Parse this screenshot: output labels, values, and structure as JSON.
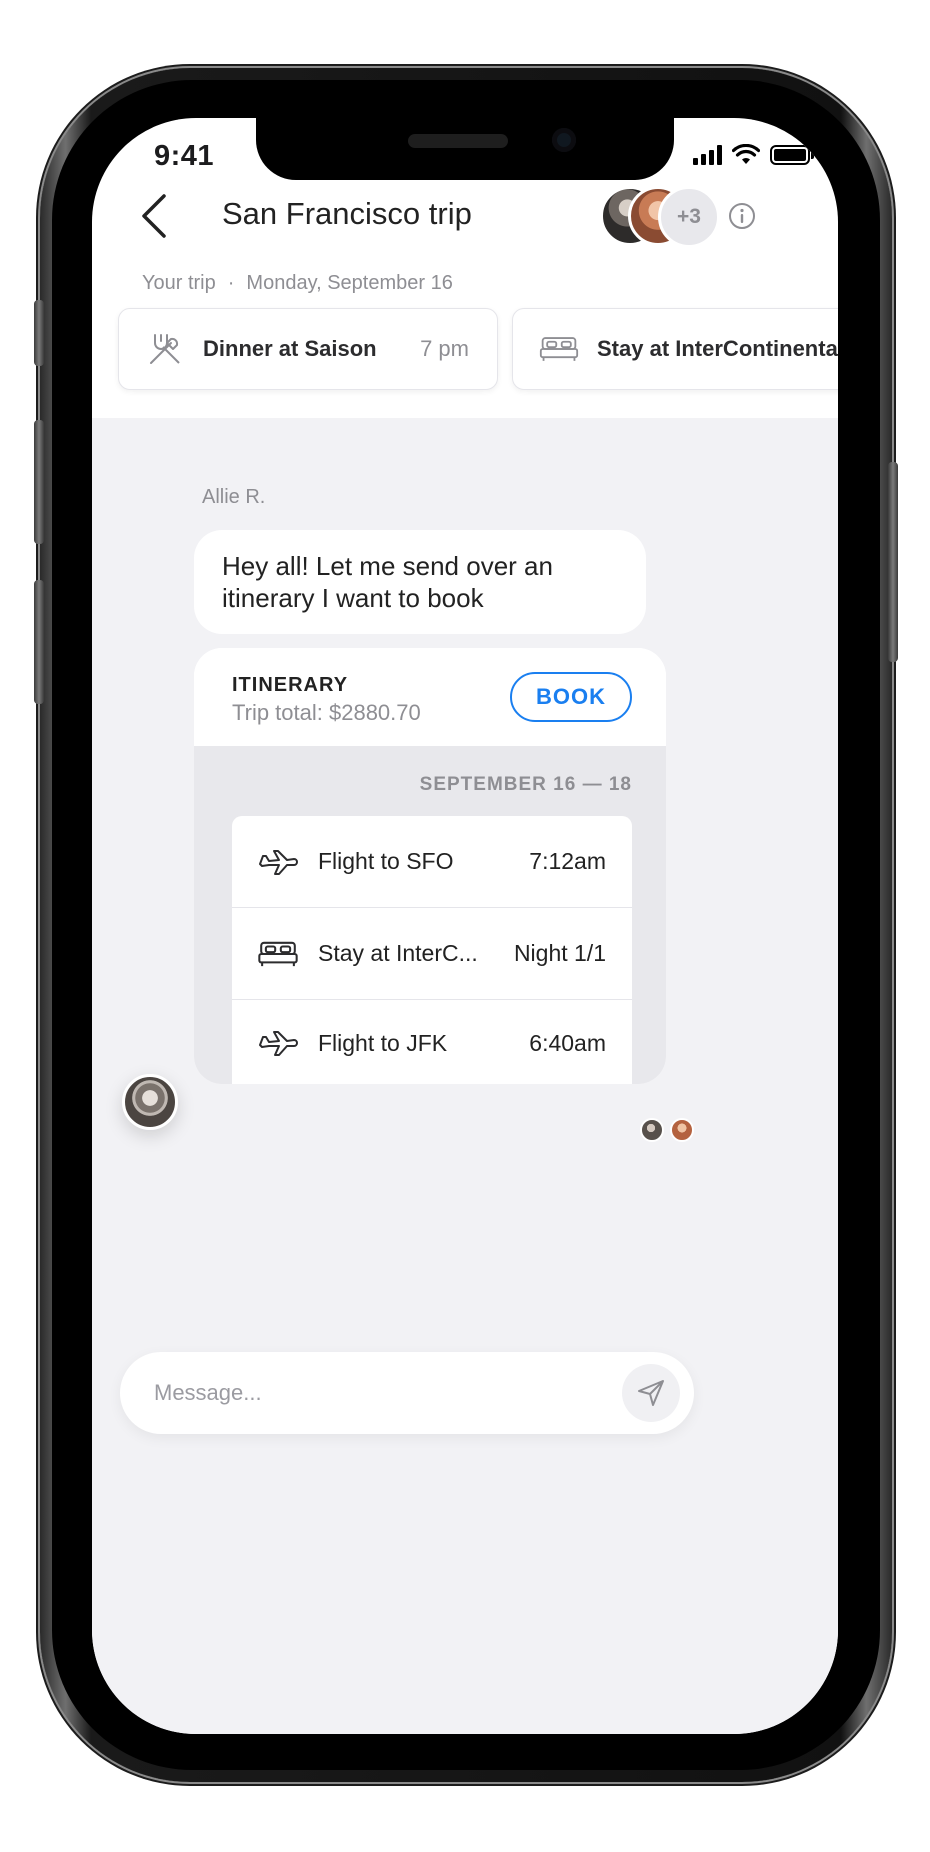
{
  "status_bar": {
    "time": "9:41"
  },
  "header": {
    "title": "San Francisco trip",
    "participants_more": "+3"
  },
  "trip_meta": {
    "label": "Your trip",
    "separator": "·",
    "date": "Monday, September 16"
  },
  "events": [
    {
      "label": "Dinner at Saison",
      "time": "7 pm",
      "icon": "fork-knife-icon"
    },
    {
      "label": "Stay at InterContinental",
      "time": "",
      "icon": "bed-icon"
    }
  ],
  "chat": {
    "sender": "Allie R.",
    "message": "Hey all! Let me send over an itinerary I want to book",
    "itinerary": {
      "label": "ITINERARY",
      "total": "Trip total: $2880.70",
      "book_label": "BOOK",
      "dates": "SEPTEMBER 16 — 18",
      "items": [
        {
          "icon": "plane-icon",
          "label": "Flight to SFO",
          "time": "7:12am"
        },
        {
          "icon": "bed-icon",
          "label": "Stay at InterC...",
          "time": "Night 1/1"
        },
        {
          "icon": "plane-icon",
          "label": "Flight to JFK",
          "time": "6:40am"
        }
      ]
    }
  },
  "composer": {
    "placeholder": "Message..."
  },
  "colors": {
    "accent": "#1a7ff0",
    "background": "#f2f2f5",
    "muted": "#8e8e93"
  }
}
